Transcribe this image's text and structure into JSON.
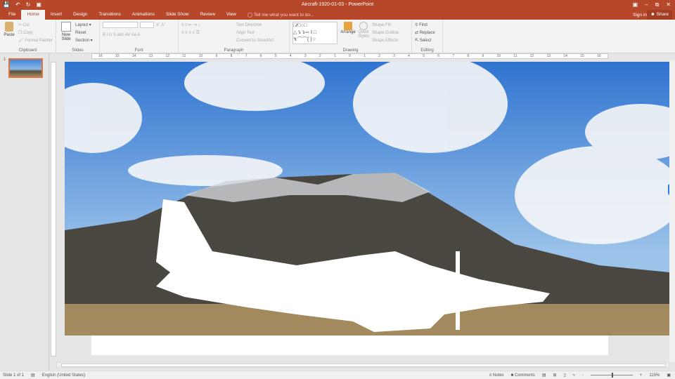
{
  "window": {
    "title": "Aircraft-1920-01-03 - PowerPoint",
    "sign_in": "Sign in",
    "share": "Share"
  },
  "tabs": [
    "File",
    "Home",
    "Insert",
    "Design",
    "Transitions",
    "Animations",
    "Slide Show",
    "Review",
    "View"
  ],
  "tell_me": "Tell me what you want to do...",
  "ribbon": {
    "clipboard": {
      "label": "Clipboard",
      "paste": "Paste",
      "cut": "Cut",
      "copy": "Copy",
      "format_painter": "Format Painter"
    },
    "slides": {
      "label": "Slides",
      "new_slide": "New Slide",
      "layout": "Layout",
      "reset": "Reset",
      "section": "Section"
    },
    "font": {
      "label": "Font",
      "buttons": "B  I  U  S  abc  AV  Aa  A"
    },
    "paragraph": {
      "label": "Paragraph",
      "text_direction": "Text Direction",
      "align_text": "Align Text",
      "convert": "Convert to SmartArt"
    },
    "drawing": {
      "label": "Drawing",
      "arrange": "Arrange",
      "quick_styles": "Quick Styles",
      "shape_fill": "Shape Fill",
      "shape_outline": "Shape Outline",
      "shape_effects": "Shape Effects"
    },
    "editing": {
      "label": "Editing",
      "find": "Find",
      "replace": "Replace",
      "select": "Select"
    }
  },
  "ruler_ticks": [
    "16",
    "15",
    "14",
    "13",
    "12",
    "11",
    "10",
    "9",
    "8",
    "7",
    "6",
    "5",
    "4",
    "3",
    "2",
    "1",
    "0",
    "1",
    "2",
    "3",
    "4",
    "5",
    "6",
    "7",
    "8",
    "9",
    "10",
    "11",
    "12",
    "13",
    "14",
    "15",
    "16"
  ],
  "thumbnail": {
    "number": "1"
  },
  "status": {
    "slide": "Slide 1 of 1",
    "language": "English (United States)",
    "notes": "Notes",
    "comments": "Comments",
    "zoom": "115%"
  },
  "colors": {
    "accent": "#b7472a"
  }
}
